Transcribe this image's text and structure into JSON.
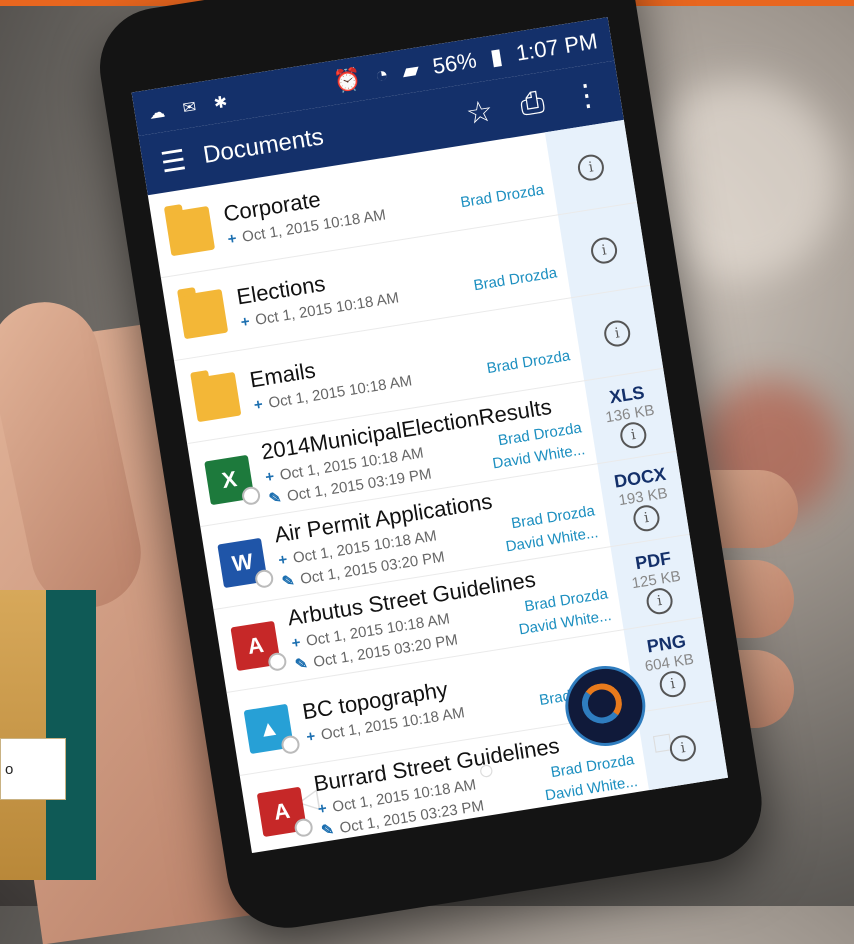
{
  "status_bar": {
    "left_icons": [
      "cloud-icon",
      "outlook-icon",
      "settings-icon"
    ],
    "right_icons": [
      "alarm-icon",
      "wifi-icon",
      "signal-icon"
    ],
    "battery": "56%",
    "time": "1:07 PM"
  },
  "app_bar": {
    "title": "Documents",
    "icons": [
      "menu-icon",
      "star-icon",
      "camera-icon",
      "more-icon"
    ]
  },
  "items": [
    {
      "name": "Corporate",
      "type": "folder",
      "created_symbol": "+",
      "created": "Oct 1, 2015 10:18 AM",
      "created_by": "Brad Drozda"
    },
    {
      "name": "Elections",
      "type": "folder",
      "created_symbol": "+",
      "created": "Oct 1, 2015 10:18 AM",
      "created_by": "Brad Drozda"
    },
    {
      "name": "Emails",
      "type": "folder",
      "created_symbol": "+",
      "created": "Oct 1, 2015 10:18 AM",
      "created_by": "Brad Drozda"
    },
    {
      "name": "2014MunicipalElectionResults",
      "type": "file",
      "icon_label": "X",
      "file_type": "XLS",
      "size": "136 KB",
      "created_symbol": "+",
      "created": "Oct 1, 2015 10:18 AM",
      "created_by": "Brad Drozda",
      "modified_symbol": "✎",
      "modified": "Oct 1, 2015 03:19 PM",
      "modified_by": "David White..."
    },
    {
      "name": "Air Permit Applications",
      "type": "file",
      "icon_label": "W",
      "file_type": "DOCX",
      "size": "193 KB",
      "created_symbol": "+",
      "created": "Oct 1, 2015 10:18 AM",
      "created_by": "Brad Drozda",
      "modified_symbol": "✎",
      "modified": "Oct 1, 2015 03:20 PM",
      "modified_by": "David White..."
    },
    {
      "name": "Arbutus Street Guidelines",
      "type": "file",
      "icon_label": "A",
      "file_type": "PDF",
      "size": "125 KB",
      "created_symbol": "+",
      "created": "Oct 1, 2015 10:18 AM",
      "created_by": "Brad Drozda",
      "modified_symbol": "✎",
      "modified": "Oct 1, 2015 03:20 PM",
      "modified_by": "David White..."
    },
    {
      "name": "BC topography",
      "type": "file",
      "icon_label": "▲",
      "file_type": "PNG",
      "size": "604 KB",
      "created_symbol": "+",
      "created": "Oct 1, 2015 10:18 AM",
      "created_by": "Brad Drozda"
    },
    {
      "name": "Burrard Street Guidelines",
      "type": "file",
      "icon_label": "A",
      "file_type": "",
      "size": "",
      "created_symbol": "+",
      "created": "Oct 1, 2015 10:18 AM",
      "created_by": "Brad Drozda",
      "modified_symbol": "✎",
      "modified": "Oct 1, 2015 03:23 PM",
      "modified_by": "David White..."
    }
  ],
  "info_glyph": "i",
  "side_card": {
    "label": "o"
  },
  "colors": {
    "accent": "#e8661f",
    "app_bar": "#14306a",
    "link": "#1c8fc0",
    "folder": "#f3b737"
  }
}
